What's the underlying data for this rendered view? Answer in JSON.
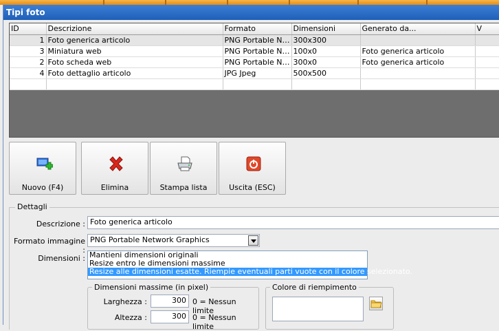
{
  "window": {
    "title": "Tipi foto"
  },
  "grid": {
    "columns": [
      "ID",
      "Descrizione",
      "Formato",
      "Dimensioni",
      "Generato da...",
      "V"
    ],
    "rows": [
      {
        "id": "1",
        "descrizione": "Foto generica articolo",
        "formato": "PNG Portable Network Graphics",
        "dimensioni": "300x300",
        "generato": ""
      },
      {
        "id": "3",
        "descrizione": "Miniatura web",
        "formato": "PNG Portable Network Graphics",
        "dimensioni": "100x0",
        "generato": "Foto generica articolo"
      },
      {
        "id": "2",
        "descrizione": "Foto scheda web",
        "formato": "PNG Portable Network Graphics",
        "dimensioni": "300x0",
        "generato": "Foto generica articolo"
      },
      {
        "id": "4",
        "descrizione": "Foto dettaglio articolo",
        "formato": "JPG Jpeg",
        "dimensioni": "500x500",
        "generato": ""
      }
    ]
  },
  "toolbar": {
    "new_label": "Nuovo (F4)",
    "delete_label": "Elimina",
    "print_label": "Stampa lista",
    "exit_label": "Uscita (ESC)"
  },
  "details": {
    "legend": "Dettagli",
    "descrizione_label": "Descrizione :",
    "descrizione_value": "Foto generica articolo",
    "formato_label": "Formato immagine :",
    "formato_value": "PNG Portable Network Graphics",
    "dimensioni_label": "Dimensioni :",
    "dimensioni_options": [
      "Mantieni dimensioni originali",
      "Resize entro le dimensioni massime",
      "Resize alle dimensioni esatte. Riempie eventuali parti vuote con il colore selezionato."
    ],
    "max_group_title": "Dimensioni massime (in pixel)",
    "larghezza_label": "Larghezza :",
    "larghezza_value": "300",
    "larghezza_hint": "0 = Nessun limite",
    "altezza_label": "Altezza :",
    "altezza_value": "300",
    "altezza_hint": "0 = Nessun limite",
    "fill_group_title": "Colore di riempimento"
  },
  "colors": {
    "title_bar": "#2a6cc8",
    "selection": "#3399ff",
    "delete_red": "#d9261c",
    "exit_red": "#d9411c"
  }
}
